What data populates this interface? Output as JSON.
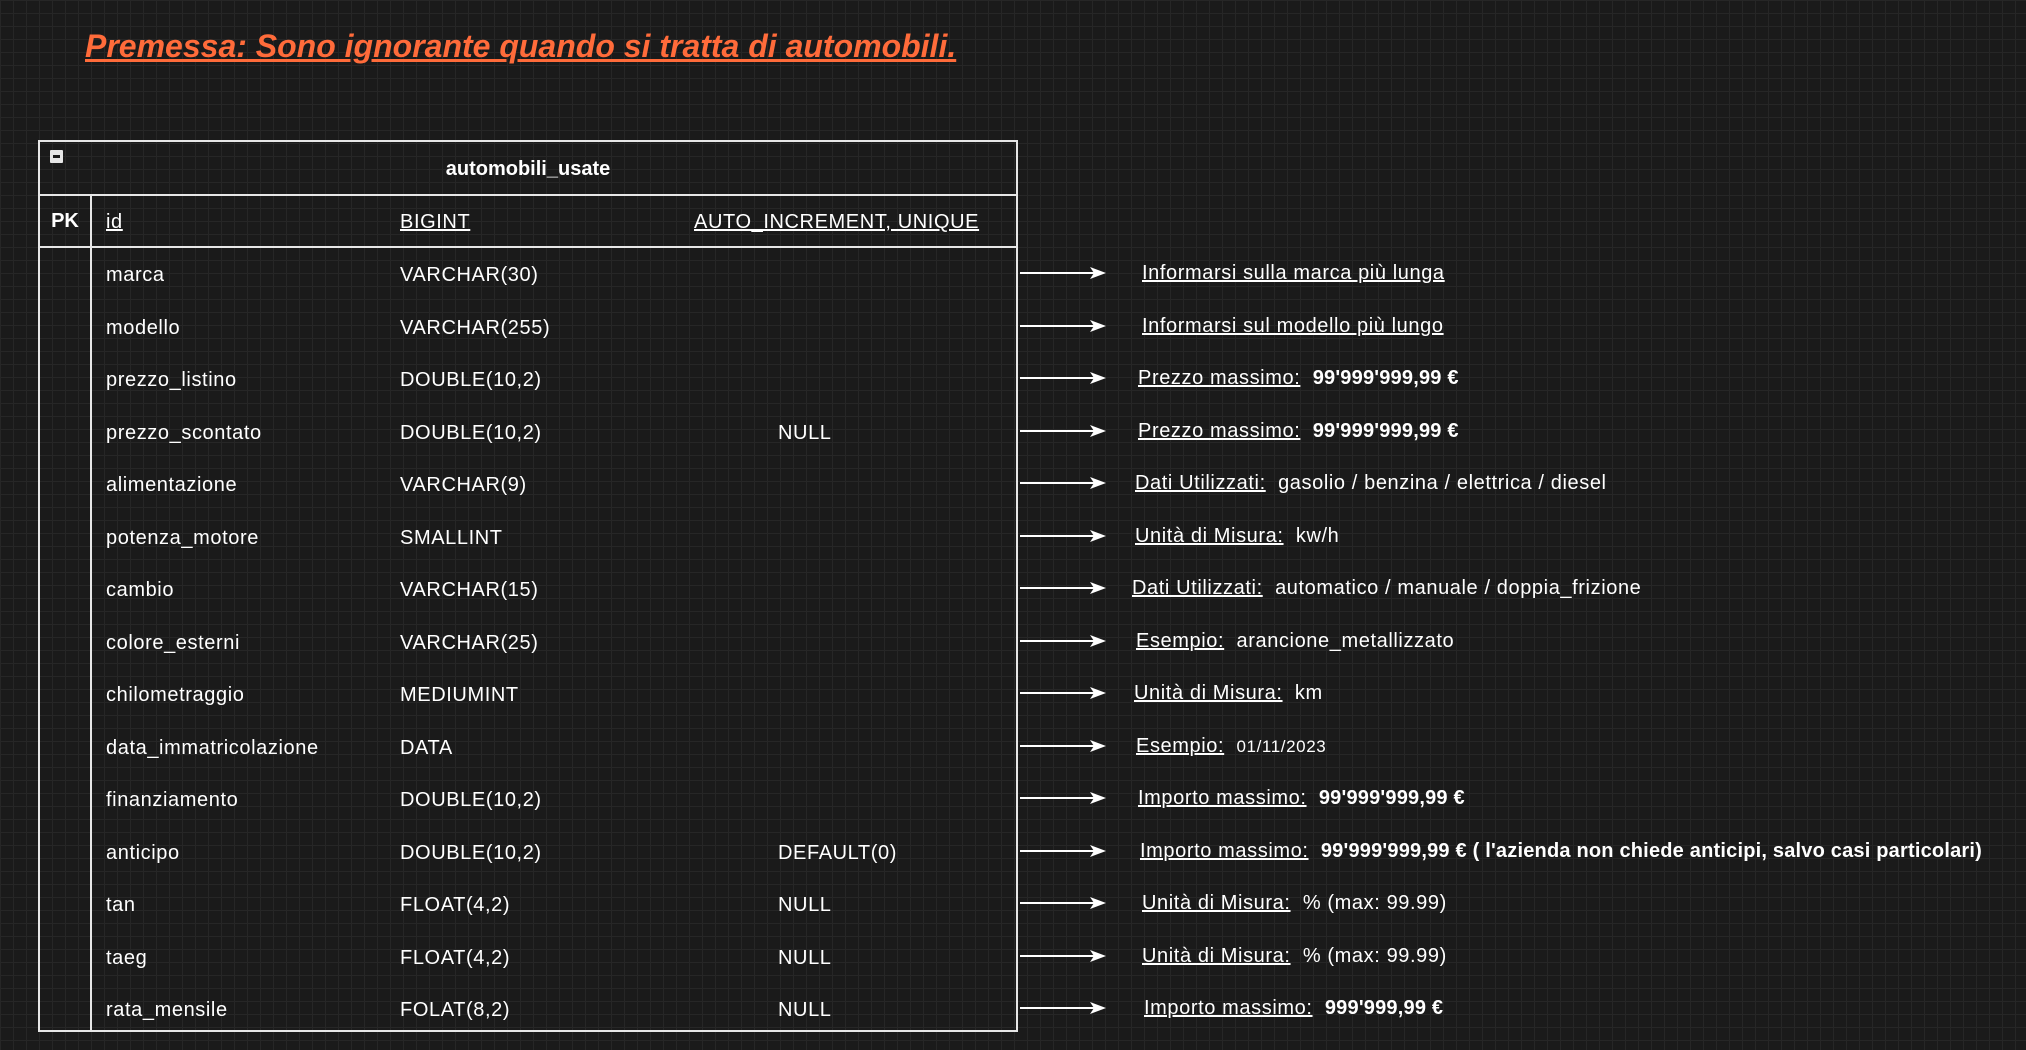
{
  "premise": "Premessa: Sono ignorante quando si tratta di automobili.",
  "table": {
    "title": "automobili_usate",
    "pk_label": "PK",
    "pk_row": {
      "name": "id",
      "type": "BIGINT",
      "constraint": "AUTO_INCREMENT, UNIQUE"
    },
    "rows": [
      {
        "name": "marca",
        "type": "VARCHAR(30)",
        "constraint": ""
      },
      {
        "name": "modello",
        "type": "VARCHAR(255)",
        "constraint": ""
      },
      {
        "name": "prezzo_listino",
        "type": "DOUBLE(10,2)",
        "constraint": ""
      },
      {
        "name": "prezzo_scontato",
        "type": "DOUBLE(10,2)",
        "constraint": "NULL"
      },
      {
        "name": "alimentazione",
        "type": "VARCHAR(9)",
        "constraint": ""
      },
      {
        "name": "potenza_motore",
        "type": "SMALLINT",
        "constraint": ""
      },
      {
        "name": "cambio",
        "type": "VARCHAR(15)",
        "constraint": ""
      },
      {
        "name": "colore_esterni",
        "type": "VARCHAR(25)",
        "constraint": ""
      },
      {
        "name": "chilometraggio",
        "type": "MEDIUMINT",
        "constraint": ""
      },
      {
        "name": "data_immatricolazione",
        "type": "DATA",
        "constraint": ""
      },
      {
        "name": "finanziamento",
        "type": "DOUBLE(10,2)",
        "constraint": ""
      },
      {
        "name": "anticipo",
        "type": "DOUBLE(10,2)",
        "constraint": "DEFAULT(0)"
      },
      {
        "name": "tan",
        "type": "FLOAT(4,2)",
        "constraint": "NULL"
      },
      {
        "name": "taeg",
        "type": "FLOAT(4,2)",
        "constraint": "NULL"
      },
      {
        "name": "rata_mensile",
        "type": "FOLAT(8,2)",
        "constraint": "NULL"
      }
    ]
  },
  "notes": [
    {
      "label": "Informarsi sulla marca più lunga",
      "value": "",
      "style": "plain"
    },
    {
      "label": "Informarsi sul modello più lungo",
      "value": "",
      "style": "plain"
    },
    {
      "label": "Prezzo massimo:",
      "value": "99'999'999,99 €",
      "style": "bold"
    },
    {
      "label": "Prezzo massimo:",
      "value": "99'999'999,99 €",
      "style": "bold"
    },
    {
      "label": "Dati Utilizzati:",
      "value": "gasolio / benzina / elettrica / diesel",
      "style": "plain"
    },
    {
      "label": "Unità di Misura:",
      "value": "kw/h",
      "style": "plain"
    },
    {
      "label": "Dati Utilizzati:",
      "value": "automatico / manuale / doppia_frizione",
      "style": "plain"
    },
    {
      "label": "Esempio:",
      "value": "arancione_metallizzato",
      "style": "plain"
    },
    {
      "label": "Unità di Misura:",
      "value": "km",
      "style": "plain"
    },
    {
      "label": "Esempio:",
      "value": "01/11/2023",
      "style": "small"
    },
    {
      "label": "Importo massimo:",
      "value": "99'999'999,99 €",
      "style": "bold"
    },
    {
      "label": "Importo massimo:",
      "value": "99'999'999,99 € ( l'azienda non chiede anticipi, salvo casi particolari)",
      "style": "bold"
    },
    {
      "label": "Unità di Misura:",
      "value": "% (max: 99.99)",
      "style": "plain"
    },
    {
      "label": "Unità di Misura:",
      "value": "% (max: 99.99)",
      "style": "plain"
    },
    {
      "label": "Importo massimo:",
      "value": "999'999,99 €",
      "style": "bold"
    }
  ],
  "colors": {
    "premise": "#ff6b3a",
    "background": "#1a1a1a",
    "lines": "#e6e6e6"
  }
}
